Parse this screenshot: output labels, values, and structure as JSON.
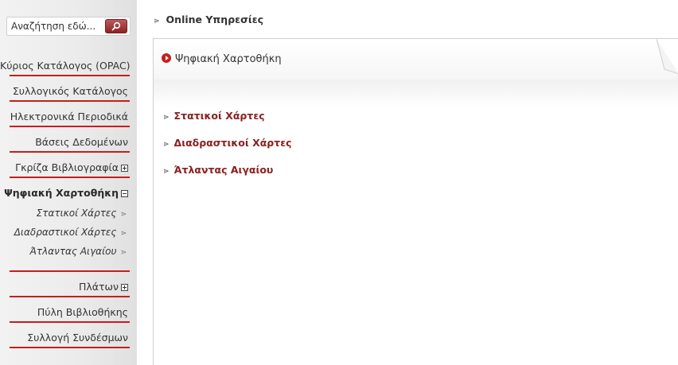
{
  "search": {
    "placeholder": "Αναζήτηση εδώ...",
    "button_icon": "search-icon"
  },
  "sidebar": {
    "items": [
      {
        "label": "Κύριος Κατάλογος (OPAC)"
      },
      {
        "label": "Συλλογικός Κατάλογος"
      },
      {
        "label": "Ηλεκτρονικά Περιοδικά"
      },
      {
        "label": "Βάσεις Δεδομένων"
      },
      {
        "label": "Γκρίζα Βιβλιογραφία",
        "toggle": "expand"
      },
      {
        "label": "Ψηφιακή Χαρτοθήκη",
        "toggle": "collapse",
        "active": true
      },
      {
        "label": "Πλάτων",
        "toggle": "expand"
      },
      {
        "label": "Πύλη Βιβλιοθήκης"
      },
      {
        "label": "Συλλογή Συνδέσμων"
      }
    ],
    "subitems": [
      {
        "label": "Στατικοί Χάρτες"
      },
      {
        "label": "Διαδραστικοί Χάρτες"
      },
      {
        "label": "Άτλαντας Αιγαίου"
      }
    ]
  },
  "breadcrumb": {
    "label": "Online Υπηρεσίες"
  },
  "panel": {
    "title": "Ψηφιακή Χαρτοθήκη",
    "links": [
      {
        "label": "Στατικοί Χάρτες"
      },
      {
        "label": "Διαδραστικοί Χάρτες"
      },
      {
        "label": "Άτλαντας Αιγαίου"
      }
    ]
  },
  "colors": {
    "accent": "#c81d1d",
    "link": "#8a2020"
  }
}
